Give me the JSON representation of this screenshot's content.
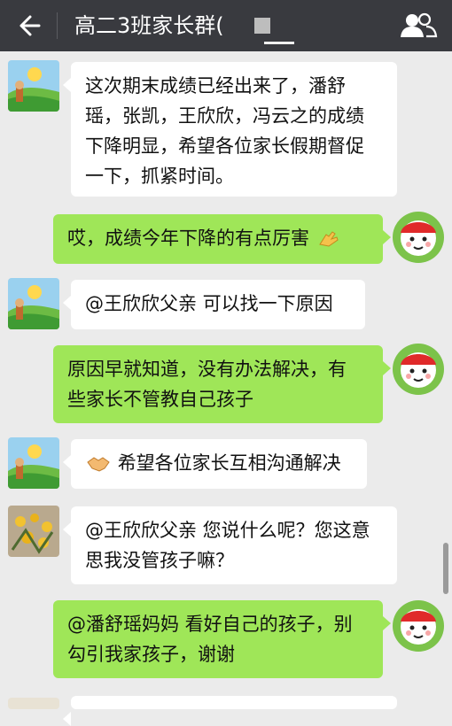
{
  "header": {
    "back_icon": "back-arrow-icon",
    "title": "高二3班家长群(",
    "members_icon": "group-members-icon"
  },
  "colors": {
    "header_bg": "#393a3f",
    "chat_bg": "#ebebeb",
    "incoming_bubble": "#ffffff",
    "outgoing_bubble": "#9fe658"
  },
  "messages": [
    {
      "side": "incoming",
      "avatar": "teacher-avatar",
      "lines": [
        "这次期末成绩已经出来了，潘舒",
        "瑶，张凯，王欣欣，冯云之的成绩",
        "下降明显，希望各位家长假期督促",
        "一下，抓紧时间。"
      ]
    },
    {
      "side": "outgoing",
      "avatar": "snowman-avatar",
      "text": "哎，成绩今年下降的有点厉害",
      "emoji": "clap-emoji"
    },
    {
      "side": "incoming",
      "avatar": "teacher-avatar",
      "text": "@王欣欣父亲 可以找一下原因"
    },
    {
      "side": "outgoing",
      "avatar": "snowman-avatar",
      "lines": [
        "原因早就知道，没有办法解决，有",
        "些家长不管教自己孩子"
      ]
    },
    {
      "side": "incoming",
      "avatar": "teacher-avatar",
      "emoji": "handshake-emoji",
      "text": "希望各位家长互相沟通解决"
    },
    {
      "side": "incoming",
      "avatar": "flowers-avatar",
      "lines": [
        "@王欣欣父亲 您说什么呢？您这意",
        "思我没管孩子嘛？"
      ]
    },
    {
      "side": "outgoing",
      "avatar": "snowman-avatar",
      "lines": [
        "@潘舒瑶妈妈 看好自己的孩子，别",
        "勾引我家孩子，谢谢"
      ]
    }
  ]
}
